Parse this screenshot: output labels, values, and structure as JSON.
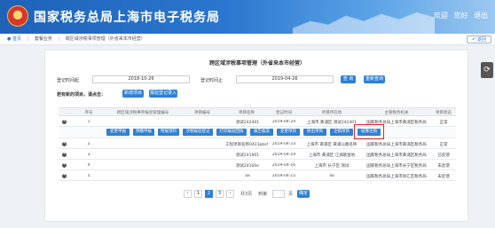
{
  "header": {
    "title": "国家税务总局上海市电子税务局",
    "welcome": "欢迎",
    "user": "您好",
    "exit": "退出"
  },
  "breadcrumb": {
    "home": "首页",
    "items": [
      "套餐业务",
      "跨区域涉税事项管理（外省来本市经营）"
    ]
  },
  "back_label": "返回",
  "page_title": "跨区域涉税事项管理（外省来本市经营）",
  "filters": {
    "start_label": "登记时间起",
    "start_value": "2018-10-26",
    "end_label": "登记时间止",
    "end_value": "2019-04-26",
    "query_label": "查 询",
    "reset_label": "重新查询"
  },
  "action_bar": {
    "hint": "若有新的项目，请点击：",
    "new_project": "新增项目",
    "paper_register": "报验登记录入"
  },
  "table": {
    "columns": [
      "序号",
      "跨区域涉税事项报验管理编号",
      "项目编号",
      "项目名称",
      "登记时间",
      "项目所在地",
      "主管税务机关",
      "项目状态"
    ],
    "rows": [
      {
        "seq": "1",
        "mgmt_no": "",
        "proj_no": "",
        "name": "测试242401",
        "date": "2019-04-24",
        "location": "上海市 黄浦区 测试242401",
        "tax_office": "国家税务总局上海市黄浦区税务局",
        "status": "正常"
      },
      {
        "seq": "2",
        "mgmt_no": "",
        "proj_no": "",
        "name": "工程项目名称0423pbsh1",
        "date": "2019-04-23",
        "location": "上海市 黄浦区 黄浦公路名称",
        "tax_office": "国家税务总局上海市黄浦区税务局",
        "status": "正常"
      },
      {
        "seq": "3",
        "mgmt_no": "",
        "proj_no": "",
        "name": "测试241901",
        "date": "2019-04-19",
        "location": "上海市 黄浦区 江湖基金地",
        "tax_office": "国家税务总局上海市黄浦区税务局",
        "status": "已反馈"
      },
      {
        "seq": "4",
        "mgmt_no": "",
        "proj_no": "",
        "name": "测试24160e",
        "date": "2019-04-16",
        "location": "上海市 长宁区 测试",
        "tax_office": "国家税务总局上海市长宁区税务局",
        "status": "未反馈"
      },
      {
        "seq": "5",
        "mgmt_no": "",
        "proj_no": "",
        "name": "aa",
        "date": "2019-04-15",
        "location": "aa",
        "tax_office": "国家税务总局上海市徐汇区税务局",
        "status": "未反馈"
      }
    ],
    "operations": [
      "变更申报",
      "预缴申报",
      "附报资料",
      "涉税报验登记",
      "打印报验回执",
      "报告备案",
      "变更项目",
      "移出项目",
      "注销项目",
      "核算注销"
    ]
  },
  "pager": {
    "pages": [
      "1",
      "2",
      "3"
    ],
    "current": "2",
    "total_text": "共3页",
    "goto_label": "到第",
    "page_suffix": "页",
    "confirm": "确定"
  },
  "colors": {
    "header": "#1f62b8",
    "button": "#2f80d3",
    "teal": "#1e9b93",
    "highlight": "#e0282d"
  }
}
